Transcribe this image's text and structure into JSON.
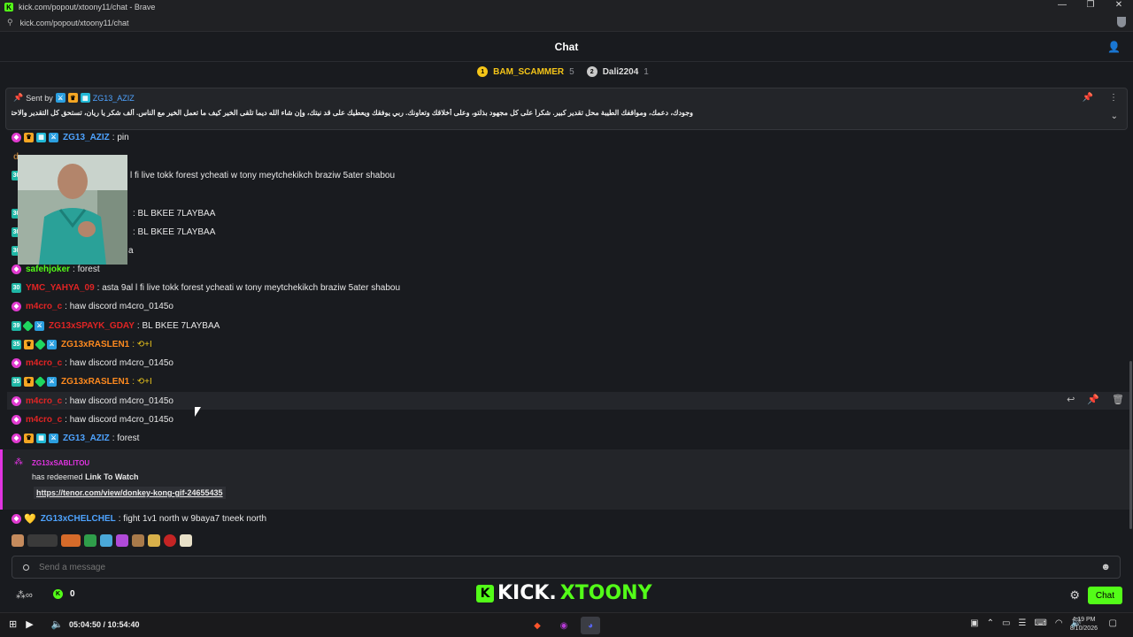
{
  "window": {
    "title": "kick.com/popout/xtoony11/chat - Brave",
    "url": "kick.com/popout/xtoony11/chat",
    "controls": [
      "—",
      "❐",
      "✕"
    ]
  },
  "chat_header": {
    "title": "Chat"
  },
  "top_gifters": [
    {
      "rank": "1",
      "name": "BAM_SCAMMER",
      "count": "5"
    },
    {
      "rank": "2",
      "name": "Dali2204",
      "count": "1"
    }
  ],
  "pinned": {
    "sent_by": "Sent by",
    "user": "ZG13_AZIZ",
    "text": "وجودك، دعمك، ومواقفك الطيبة محل تقدير كبير. شكراً على كل مجهود بذلتو، وعلى أخلاقك وتعاونك. ربي يوفقك ويعطيك على قد نيتك، وإن شاء الله ديما تلقى الخير كيف ما تعمل الخير مع الناس. ألف شكر يا ريان، تستحق كل التقدير والاحترام ❤"
  },
  "messages": [
    {
      "badge": "30",
      "user": "ZG13_AZIZ",
      "text": ": pin",
      "color": "c-blue"
    },
    {
      "user": "d",
      "text": "",
      "color": "c-tan"
    },
    {
      "user": "",
      "text": "l fi live tokk forest ycheati w tony meytchekikch braziw 5ater shabou",
      "color": "c-red"
    },
    {
      "user": "",
      "text": ": BL BKEE 7LAYBAA",
      "color": "c-red"
    },
    {
      "user": "",
      "text": ": BL BKEE 7LAYBAA",
      "color": "c-red"
    },
    {
      "user": "",
      "text": "a",
      "color": "c-red"
    },
    {
      "user": "safehjoker",
      "text": ": forest",
      "color": "c-green"
    },
    {
      "badge": "30",
      "user": "YMC_YAHYA_09",
      "text": ": asta 9al l fi live tokk forest ycheati w tony meytchekikch braziw 5ater shabou",
      "color": "c-red"
    },
    {
      "user": "m4cro_c",
      "text": ": haw discord m4cro_0145o",
      "color": "c-red"
    },
    {
      "badge": "39",
      "user": "ZG13xSPAYK_GDAY",
      "text": ": BL BKEE 7LAYBAA",
      "color": "c-red"
    },
    {
      "badge": "35",
      "user": "ZG13xRASLEN1",
      "text": ": ⟲+I",
      "color": "c-orange"
    },
    {
      "user": "m4cro_c",
      "text": ": haw discord m4cro_0145o",
      "color": "c-red"
    },
    {
      "badge": "35",
      "user": "ZG13xRASLEN1",
      "text": ": ⟲+I",
      "color": "c-orange"
    },
    {
      "user": "m4cro_c",
      "text": ": haw discord m4cro_0145o",
      "color": "c-red"
    },
    {
      "user": "m4cro_c",
      "text": ": haw discord m4cro_0145o",
      "color": "c-red"
    },
    {
      "user": "ZG13_AZIZ",
      "text": ": forest",
      "color": "c-blue"
    }
  ],
  "redeem": {
    "user": "ZG13xSABLITOU",
    "text": "has redeemed",
    "reward": "Link To Watch",
    "link": "https://tenor.com/view/donkey-kong-gif-24655435"
  },
  "last_message": {
    "user": "ZG13xCHELCHEL",
    "text": ": fight 1v1 north w 9baya7 tneek north"
  },
  "input": {
    "placeholder": "Send a message"
  },
  "footer": {
    "points": "0",
    "brand_a": "KICK.",
    "brand_b": "XTOONY",
    "chat_button": "Chat"
  },
  "taskbar": {
    "time": "05:04:50 / 10:54:40",
    "clock_time": "4:19 PM",
    "clock_date": "8/10/2026"
  },
  "colors": {
    "accent": "#53fc18",
    "background": "#191b1f",
    "vip": "#e134e1"
  }
}
